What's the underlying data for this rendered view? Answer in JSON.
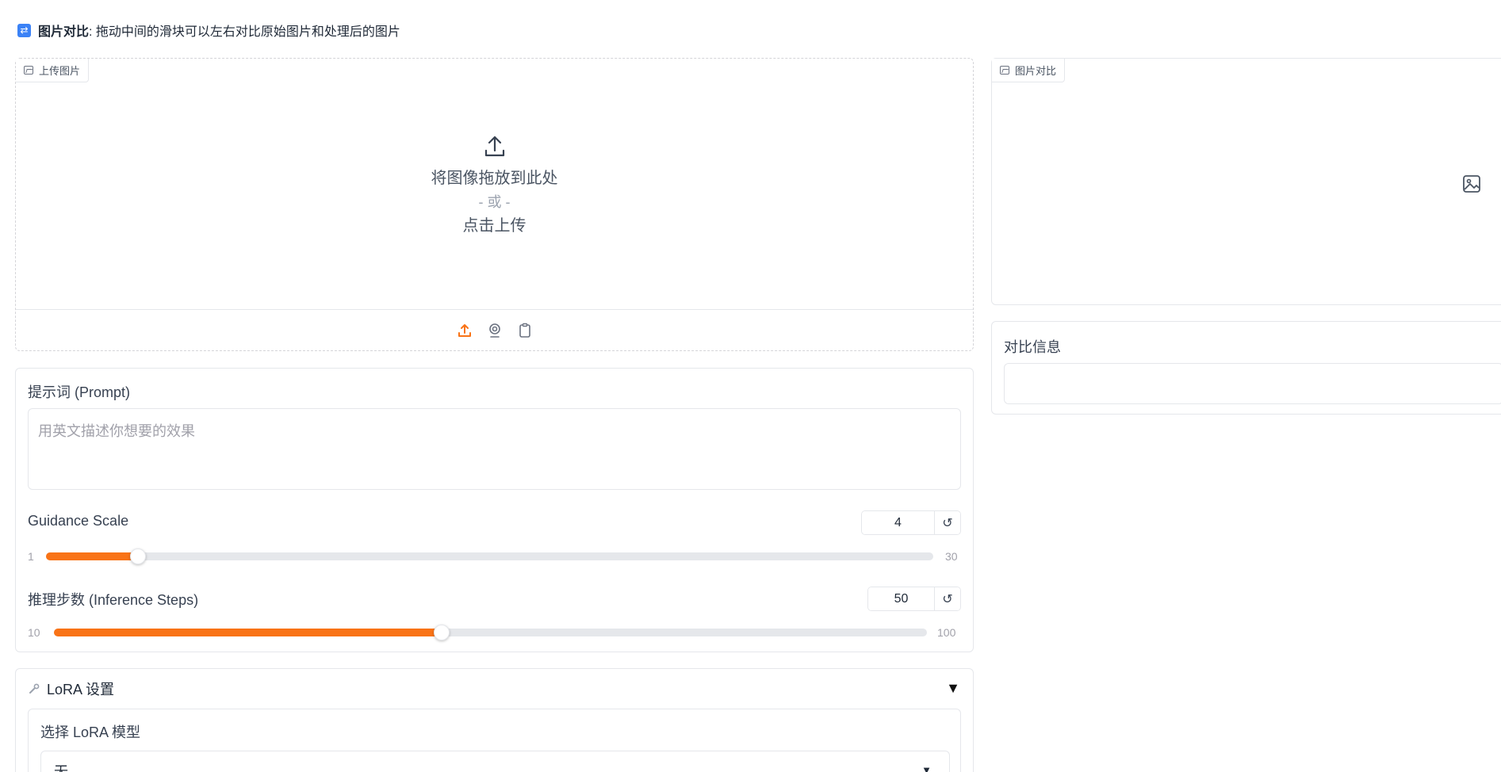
{
  "heading": {
    "bold": "图片对比",
    "text": ": 拖动中间的滑块可以左右对比原始图片和处理后的图片"
  },
  "upload": {
    "label": "上传图片",
    "drop_text": "将图像拖放到此处",
    "or_text": "- 或 -",
    "click_text": "点击上传",
    "sources": [
      "upload-icon",
      "webcam-icon",
      "clipboard-icon"
    ]
  },
  "compare": {
    "label": "图片对比",
    "placeholder_icon": "image-icon"
  },
  "info": {
    "label": "对比信息",
    "value": ""
  },
  "prompt": {
    "label": "提示词 (Prompt)",
    "placeholder": "用英文描述你想要的效果",
    "value": ""
  },
  "guidance": {
    "label": "Guidance Scale",
    "value": 4,
    "min": 1,
    "max": 30,
    "reset_icon": "↺"
  },
  "steps": {
    "label": "推理步数 (Inference Steps)",
    "value": 50,
    "min": 10,
    "max": 100,
    "reset_icon": "↺"
  },
  "lora": {
    "icon": "wrench-icon",
    "title": "LoRA 设置",
    "toggle": "▼",
    "select_label": "选择 LoRA 模型",
    "selected": "无",
    "caret": "▼"
  },
  "colors": {
    "accent": "#f97316",
    "heading_tag": "#3b82f6",
    "border": "#e5e7eb"
  }
}
